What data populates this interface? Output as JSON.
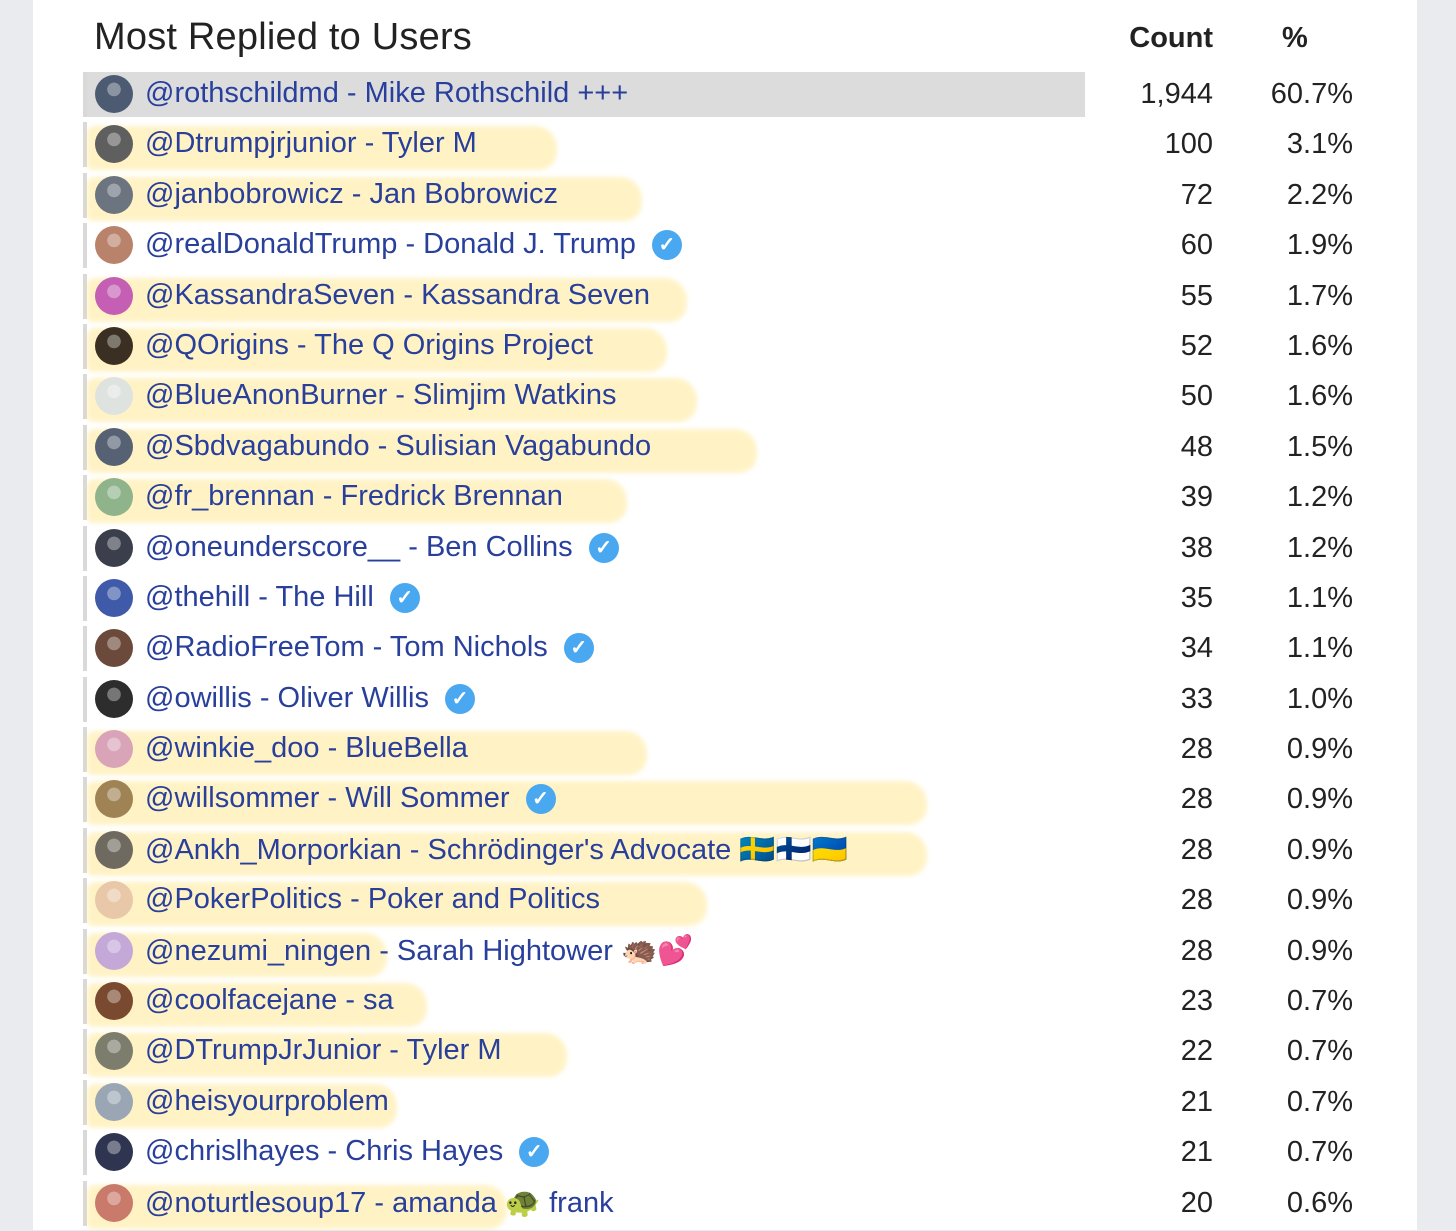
{
  "table": {
    "title": "Most Replied to Users",
    "col_count": "Count",
    "col_pct": "%",
    "rows": [
      {
        "user": "@rothschildmd - Mike Rothschild +++",
        "count": "1,944",
        "pct": "60.7%",
        "selected": true,
        "verified": false,
        "highlight": 0,
        "avatar": "#4d5b72"
      },
      {
        "user": "@Dtrumpjrjunior - Tyler M",
        "count": "100",
        "pct": "3.1%",
        "verified": false,
        "highlight": 470,
        "avatar": "#5f5f5f"
      },
      {
        "user": "@janbobrowicz - Jan Bobrowicz",
        "count": "72",
        "pct": "2.2%",
        "verified": false,
        "highlight": 555,
        "avatar": "#6c7480"
      },
      {
        "user": "@realDonaldTrump - Donald J. Trump",
        "count": "60",
        "pct": "1.9%",
        "verified": true,
        "highlight": 0,
        "avatar": "#b9826b"
      },
      {
        "user": "@KassandraSeven - Kassandra Seven",
        "count": "55",
        "pct": "1.7%",
        "verified": false,
        "highlight": 600,
        "avatar": "#c45fb4"
      },
      {
        "user": "@QOrigins - The Q Origins Project",
        "count": "52",
        "pct": "1.6%",
        "verified": false,
        "highlight": 580,
        "avatar": "#3a2f22"
      },
      {
        "user": "@BlueAnonBurner - Slimjim Watkins",
        "count": "50",
        "pct": "1.6%",
        "verified": false,
        "highlight": 610,
        "avatar": "#dfe3e0"
      },
      {
        "user": "@Sbdvagabundo - Sulisian Vagabundo",
        "count": "48",
        "pct": "1.5%",
        "verified": false,
        "highlight": 670,
        "avatar": "#566273"
      },
      {
        "user": "@fr_brennan - Fredrick Brennan",
        "count": "39",
        "pct": "1.2%",
        "verified": false,
        "highlight": 540,
        "avatar": "#8fb38a"
      },
      {
        "user": "@oneunderscore__ - Ben Collins",
        "count": "38",
        "pct": "1.2%",
        "verified": true,
        "highlight": 0,
        "avatar": "#3b3f4b"
      },
      {
        "user": "@thehill - The Hill",
        "count": "35",
        "pct": "1.1%",
        "verified": true,
        "highlight": 0,
        "avatar": "#3e5aa8"
      },
      {
        "user": "@RadioFreeTom - Tom Nichols",
        "count": "34",
        "pct": "1.1%",
        "verified": true,
        "highlight": 0,
        "avatar": "#6b4a3b"
      },
      {
        "user": "@owillis - Oliver Willis",
        "count": "33",
        "pct": "1.0%",
        "verified": true,
        "highlight": 0,
        "avatar": "#2d2d2d"
      },
      {
        "user": "@winkie_doo - BlueBella",
        "count": "28",
        "pct": "0.9%",
        "verified": false,
        "highlight": 560,
        "avatar": "#d9a3b8"
      },
      {
        "user": "@willsommer - Will Sommer",
        "count": "28",
        "pct": "0.9%",
        "verified": true,
        "highlight": 840,
        "avatar": "#a08355"
      },
      {
        "user": "@Ankh_Morporkian - Schrödinger's Advocate 🇸🇪🇫🇮🇺🇦",
        "count": "28",
        "pct": "0.9%",
        "verified": false,
        "highlight": 840,
        "avatar": "#6f6a60"
      },
      {
        "user": "@PokerPolitics - Poker and Politics",
        "count": "28",
        "pct": "0.9%",
        "verified": false,
        "highlight": 620,
        "avatar": "#e8c8a8"
      },
      {
        "user": "@nezumi_ningen",
        "count": "28",
        "pct": "0.9%",
        "verified": false,
        "highlight": 300,
        "avatar": "#c4a8d8",
        "suffix": " - Sarah Hightower 🦔💕"
      },
      {
        "user": "@coolfacejane - sa",
        "count": "23",
        "pct": "0.7%",
        "verified": false,
        "highlight": 340,
        "avatar": "#7a4a30"
      },
      {
        "user": "@DTrumpJrJunior - Tyler M",
        "count": "22",
        "pct": "0.7%",
        "verified": false,
        "highlight": 480,
        "avatar": "#7d7d6d"
      },
      {
        "user": "@heisyourproblem",
        "count": "21",
        "pct": "0.7%",
        "verified": false,
        "highlight": 310,
        "avatar": "#9aa6b4"
      },
      {
        "user": "@chrislhayes - Chris Hayes",
        "count": "21",
        "pct": "0.7%",
        "verified": true,
        "highlight": 0,
        "avatar": "#2f3550"
      },
      {
        "user": "@noturtlesoup17 - amanda 🐢",
        "count": "20",
        "pct": "0.6%",
        "verified": false,
        "highlight": 420,
        "avatar": "#c97a6a",
        "suffix": " frank"
      }
    ]
  }
}
